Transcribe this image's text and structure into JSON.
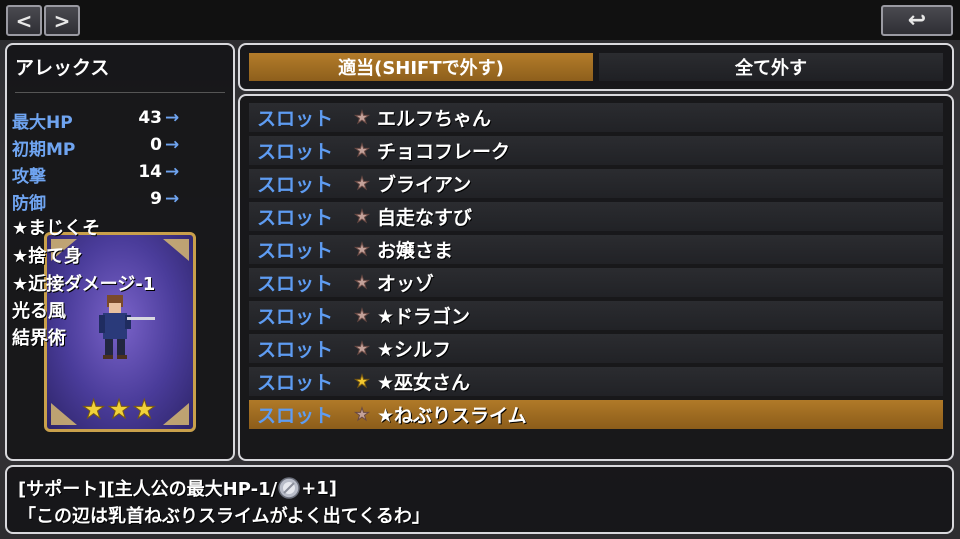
{
  "nav": {
    "prev_label": "<",
    "next_label": ">",
    "back_label": "↩"
  },
  "character": {
    "name": "アレックス",
    "stats": [
      {
        "label": "最大HP",
        "value": "43",
        "arrow": "→"
      },
      {
        "label": "初期MP",
        "value": "0",
        "arrow": "→"
      },
      {
        "label": "攻撃",
        "value": "14",
        "arrow": "→"
      },
      {
        "label": "防御",
        "value": "9",
        "arrow": "→"
      }
    ],
    "skills": [
      "★まじくそ",
      "★捨て身",
      "★近接ダメージ-1",
      "光る風",
      "結界術"
    ],
    "card_stars": 3
  },
  "tabs": {
    "auto_label": "適当(SHIFTで外す)",
    "remove_all_label": "全て外す"
  },
  "slots": [
    {
      "label": "スロット",
      "name": "エルフちゃん",
      "star": "copper",
      "selected": false
    },
    {
      "label": "スロット",
      "name": "チョコフレーク",
      "star": "copper",
      "selected": false
    },
    {
      "label": "スロット",
      "name": "ブライアン",
      "star": "copper",
      "selected": false
    },
    {
      "label": "スロット",
      "name": "自走なすび",
      "star": "copper",
      "selected": false
    },
    {
      "label": "スロット",
      "name": "お嬢さま",
      "star": "copper",
      "selected": false
    },
    {
      "label": "スロット",
      "name": "オッゾ",
      "star": "copper",
      "selected": false
    },
    {
      "label": "スロット",
      "name": "★ドラゴン",
      "star": "copper",
      "selected": false
    },
    {
      "label": "スロット",
      "name": "★シルフ",
      "star": "copper",
      "selected": false
    },
    {
      "label": "スロット",
      "name": "★巫女さん",
      "star": "gold",
      "selected": false
    },
    {
      "label": "スロット",
      "name": "★ねぶりスライム",
      "star": "copper",
      "selected": true
    }
  ],
  "description": {
    "line1_before": "[サポート][主人公の最大HP-1/",
    "line1_after": "+1]",
    "line2": "「この辺は乳首ねぶりスライムがよく出てくるわ」"
  },
  "colors": {
    "accent_blue": "#6fa4f0",
    "selected_row": "#a06c22",
    "star_gold": "#f3c830",
    "star_copper": "#c4a29a"
  }
}
